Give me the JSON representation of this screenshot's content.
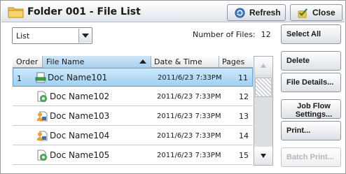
{
  "window": {
    "title": "Folder 001 - File List"
  },
  "toolbar": {
    "refresh_label": "Refresh",
    "close_label": "Close"
  },
  "view": {
    "selected": "List"
  },
  "summary": {
    "files_label": "Number of Files:",
    "files_count": "12"
  },
  "table": {
    "columns": {
      "order": "Order",
      "name": "File Name",
      "date": "Date & Time",
      "pages": "Pages"
    },
    "rows": [
      {
        "order": "1",
        "name": "Doc Name101",
        "date": "2011/6/23 7:33PM",
        "pages": "11",
        "icon": "document-scan-icon"
      },
      {
        "order": "",
        "name": "Doc Name102",
        "date": "2011/6/23 7:33PM",
        "pages": "12",
        "icon": "fax-document-icon"
      },
      {
        "order": "",
        "name": "Doc Name103",
        "date": "2011/6/23 7:33PM",
        "pages": "13",
        "icon": "person-document-icon"
      },
      {
        "order": "",
        "name": "Doc Name104",
        "date": "2011/6/23 7:33PM",
        "pages": "14",
        "icon": "person-document-icon"
      },
      {
        "order": "",
        "name": "Doc Name105",
        "date": "2011/6/23 7:33PM",
        "pages": "15",
        "icon": "fax-document-icon"
      }
    ]
  },
  "actions": {
    "select_all": "Select All",
    "delete": "Delete",
    "file_details": "File Details...",
    "job_flow": "Job Flow Settings...",
    "print": "Print...",
    "batch_print": "Batch Print..."
  },
  "colors": {
    "selected_row": "#a9d6f4",
    "header_bg": "#e4e7ea",
    "disabled_text": "#b3b7bc"
  }
}
